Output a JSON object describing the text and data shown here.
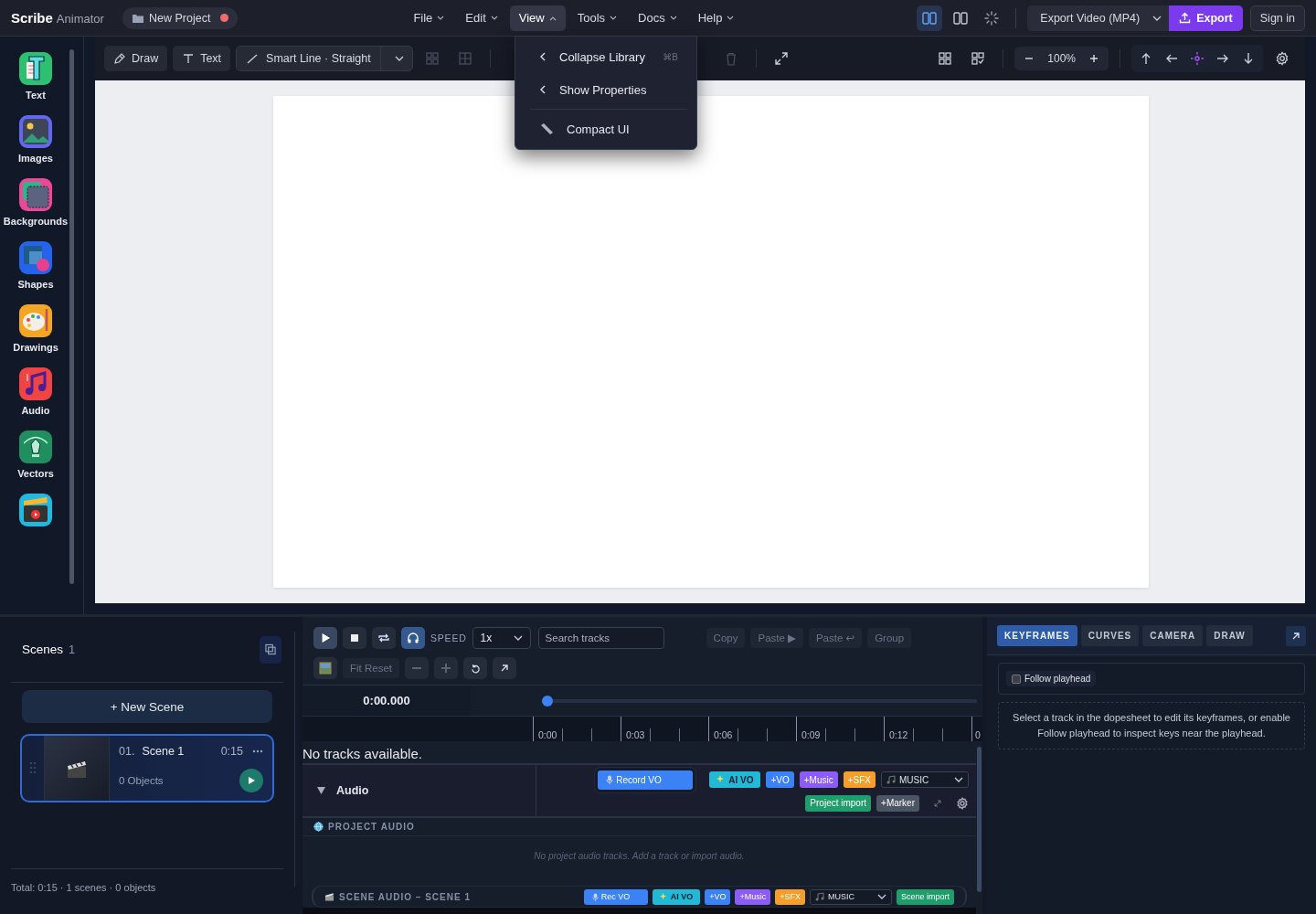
{
  "app": {
    "brand": "Scribe",
    "brand_sub": "Animator",
    "project": "New Project",
    "unsaved": true
  },
  "menu": [
    {
      "label": "File",
      "expanded": false
    },
    {
      "label": "Edit",
      "expanded": false
    },
    {
      "label": "View",
      "expanded": true
    },
    {
      "label": "Tools",
      "expanded": false
    },
    {
      "label": "Docs",
      "expanded": false
    },
    {
      "label": "Help",
      "expanded": false
    }
  ],
  "view_menu": [
    {
      "kind": "back",
      "label": "Collapse Library",
      "shortcut": "⌘B"
    },
    {
      "kind": "back",
      "label": "Show Properties"
    },
    {
      "kind": "tool",
      "label": "Compact UI"
    }
  ],
  "layout_modes": [
    {
      "selected": true
    },
    {
      "selected": false
    }
  ],
  "export": {
    "format": "Export Video (MP4)",
    "button": "Export"
  },
  "sign_in": "Sign in",
  "library": [
    {
      "kind": "text",
      "label": "Text"
    },
    {
      "kind": "images",
      "label": "Images"
    },
    {
      "kind": "backgrounds",
      "label": "Backgrounds"
    },
    {
      "kind": "shapes",
      "label": "Shapes"
    },
    {
      "kind": "drawings",
      "label": "Drawings"
    },
    {
      "kind": "audio",
      "label": "Audio"
    },
    {
      "kind": "vectors",
      "label": "Vectors"
    },
    {
      "kind": "video"
    }
  ],
  "toolbar": {
    "draw": "Draw",
    "text": "Text",
    "line": "Smart Line · Straight",
    "zoom": "100%"
  },
  "scenes": {
    "title": "Scenes",
    "count": "1",
    "new_scene": "+ New Scene",
    "items": [
      {
        "number": "01.",
        "name": "Scene 1",
        "duration": "0:15",
        "objects": "0 Objects",
        "selected": true
      }
    ],
    "total": "Total: 0:15 · 1 scenes · 0 objects"
  },
  "timeline": {
    "monitor_on": true,
    "speed_label": "SPEED",
    "speed": "1x",
    "search_placeholder": "Search tracks",
    "edit_buttons": [
      "Copy",
      "Paste ▶",
      "Paste ↩",
      "Group"
    ],
    "fit_reset": "Fit Reset",
    "time": "0:00.000",
    "playhead": {
      "level": 0
    },
    "ticks": [
      "0:00",
      "0:03",
      "0:06",
      "0:09",
      "0:12",
      "0"
    ],
    "empty": "No tracks available.",
    "audio_group": {
      "label": "Audio",
      "expanded": true,
      "chips": [
        {
          "kind": "record",
          "label": "Record VO",
          "color": "#3b82f6"
        },
        {
          "kind": "ai",
          "label": "AI VO",
          "color": "#22b8d6"
        },
        {
          "kind": "add",
          "label": "+VO",
          "color": "#3b82f6"
        },
        {
          "kind": "add",
          "label": "+Music",
          "color": "#8b5cf6"
        },
        {
          "kind": "add",
          "label": "+SFX",
          "color": "#f59e2b"
        }
      ],
      "select": "MUSIC",
      "chips2": [
        {
          "label": "Project import",
          "color": "#1f9d6b"
        },
        {
          "label": "+Marker",
          "color": "#4b5563"
        }
      ]
    },
    "project_audio": {
      "title": "PROJECT AUDIO",
      "empty": "No project audio tracks. Add a track or import audio."
    },
    "scene_audio": {
      "title": "SCENE AUDIO – SCENE 1",
      "chips": [
        {
          "kind": "record",
          "label": "Rec VO",
          "color": "#3b82f6"
        },
        {
          "kind": "ai",
          "label": "AI VO",
          "color": "#22b8d6"
        },
        {
          "kind": "add",
          "label": "+VO",
          "color": "#3b82f6"
        },
        {
          "kind": "add",
          "label": "+Music",
          "color": "#8b5cf6"
        },
        {
          "kind": "add",
          "label": "+SFX",
          "color": "#f59e2b"
        }
      ],
      "select": "MUSIC",
      "chips2": [
        {
          "label": "Scene import",
          "color": "#1f9d6b"
        }
      ]
    }
  },
  "inspector": {
    "tabs": [
      {
        "label": "KEYFRAMES",
        "selected": true
      },
      {
        "label": "CURVES",
        "selected": false
      },
      {
        "label": "CAMERA",
        "selected": false
      },
      {
        "label": "DRAW",
        "selected": false
      }
    ],
    "follow_playhead": {
      "label": "Follow playhead",
      "checked": false
    },
    "hint": "Select a track in the dopesheet to edit its keyframes, or enable Follow playhead to inspect keys near the playhead."
  }
}
